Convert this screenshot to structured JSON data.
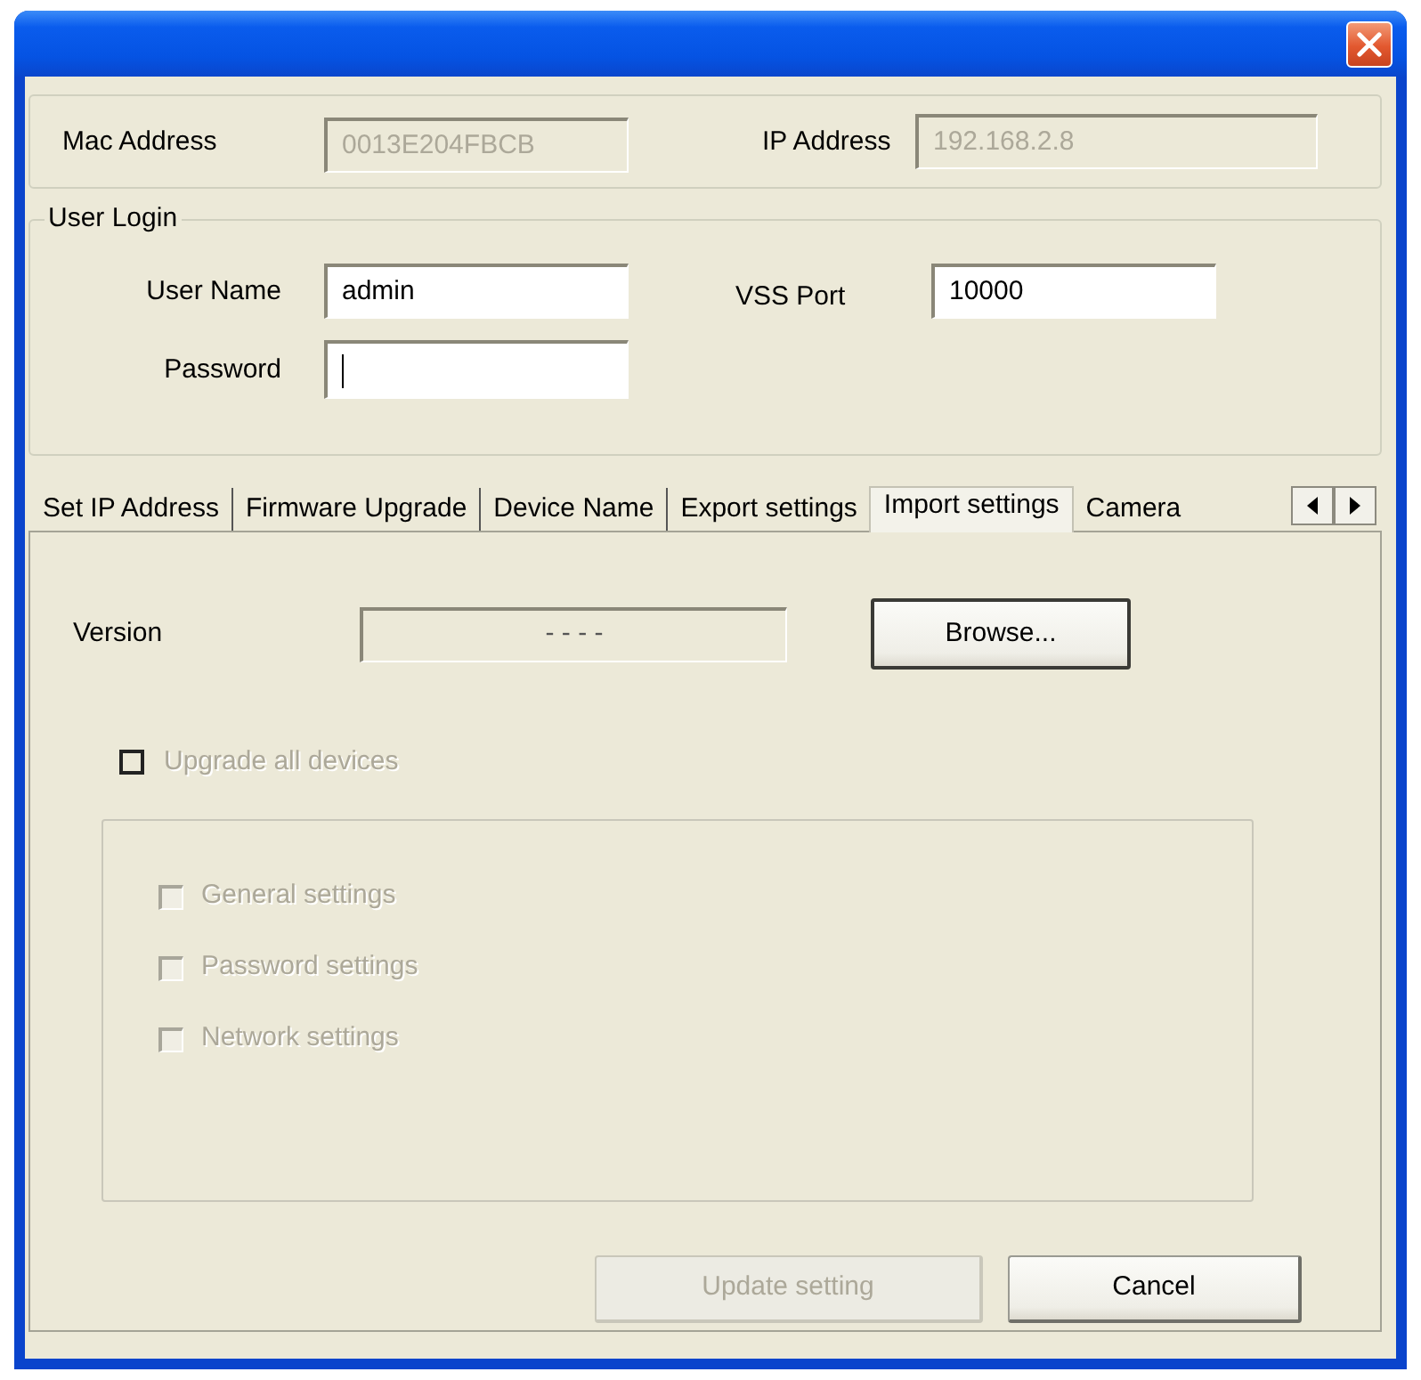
{
  "device_info": {
    "mac_address": {
      "label": "Mac Address",
      "value": "0013E204FBCB",
      "disabled": true
    },
    "ip_address": {
      "label": "IP Address",
      "value": "192.168.2.8",
      "disabled": true
    }
  },
  "user_login": {
    "title": "User Login",
    "user_name": {
      "label": "User Name",
      "value": "admin",
      "focused": false
    },
    "password": {
      "label": "Password",
      "focused": true
    },
    "vss_port": {
      "label": "VSS Port",
      "value": "10000",
      "focused": false
    }
  },
  "tabs": [
    {
      "label": "Set IP Address",
      "selected": false
    },
    {
      "label": "Firmware Upgrade",
      "selected": false
    },
    {
      "label": "Device Name",
      "selected": false
    },
    {
      "label": "Export settings",
      "selected": false
    },
    {
      "label": "Import settings",
      "selected": true
    },
    {
      "label": "Camera",
      "selected": false
    }
  ],
  "import_settings": {
    "version": {
      "label": "Version",
      "value": "- - - -",
      "disabled": true
    },
    "browse_button": "Browse...",
    "upgrade_all": {
      "label": "Upgrade all devices",
      "checked": false,
      "disabled": true
    },
    "options": [
      {
        "label": "General settings",
        "checked": false,
        "disabled": true
      },
      {
        "label": "Password settings",
        "checked": false,
        "disabled": true
      },
      {
        "label": "Network settings",
        "checked": false,
        "disabled": true
      }
    ]
  },
  "buttons": [
    {
      "label": "Update setting",
      "disabled": true
    },
    {
      "label": "Cancel",
      "disabled": false
    }
  ]
}
